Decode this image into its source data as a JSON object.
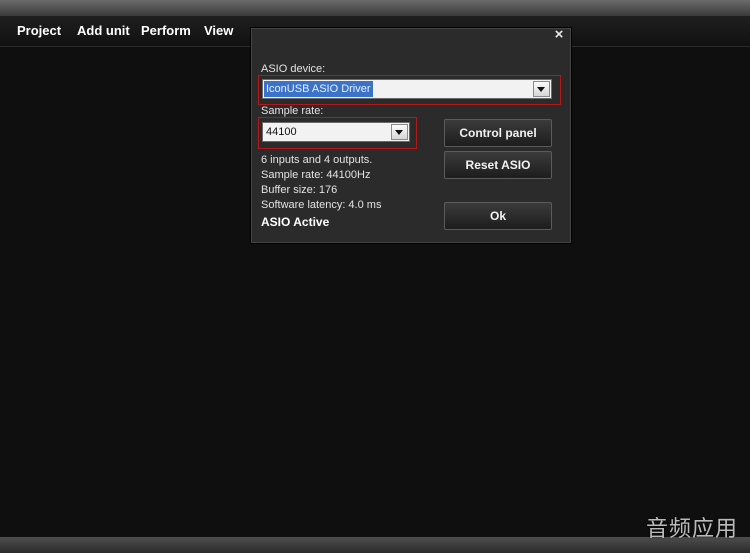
{
  "menu": {
    "items": [
      "Project",
      "Add unit",
      "Perform",
      "View"
    ]
  },
  "dialog": {
    "close_glyph": "×",
    "asio_device": {
      "label": "ASIO device:",
      "value": "IconUSB ASIO Driver"
    },
    "sample_rate": {
      "label": "Sample rate:",
      "value": "44100"
    },
    "buttons": {
      "control_panel": "Control panel",
      "reset_asio": "Reset ASIO",
      "ok": "Ok"
    },
    "info": {
      "io": "6 inputs and 4 outputs.",
      "sample_rate": "Sample rate: 44100Hz",
      "buffer_size": "Buffer size: 176",
      "latency": "Software latency: 4.0 ms",
      "status": "ASIO Active"
    }
  },
  "watermark": "音频应用",
  "colors": {
    "background": "#0f0f0f",
    "dialog": "#2b2b2b",
    "highlight_border": "#b31919",
    "selection": "#3b73c9"
  }
}
